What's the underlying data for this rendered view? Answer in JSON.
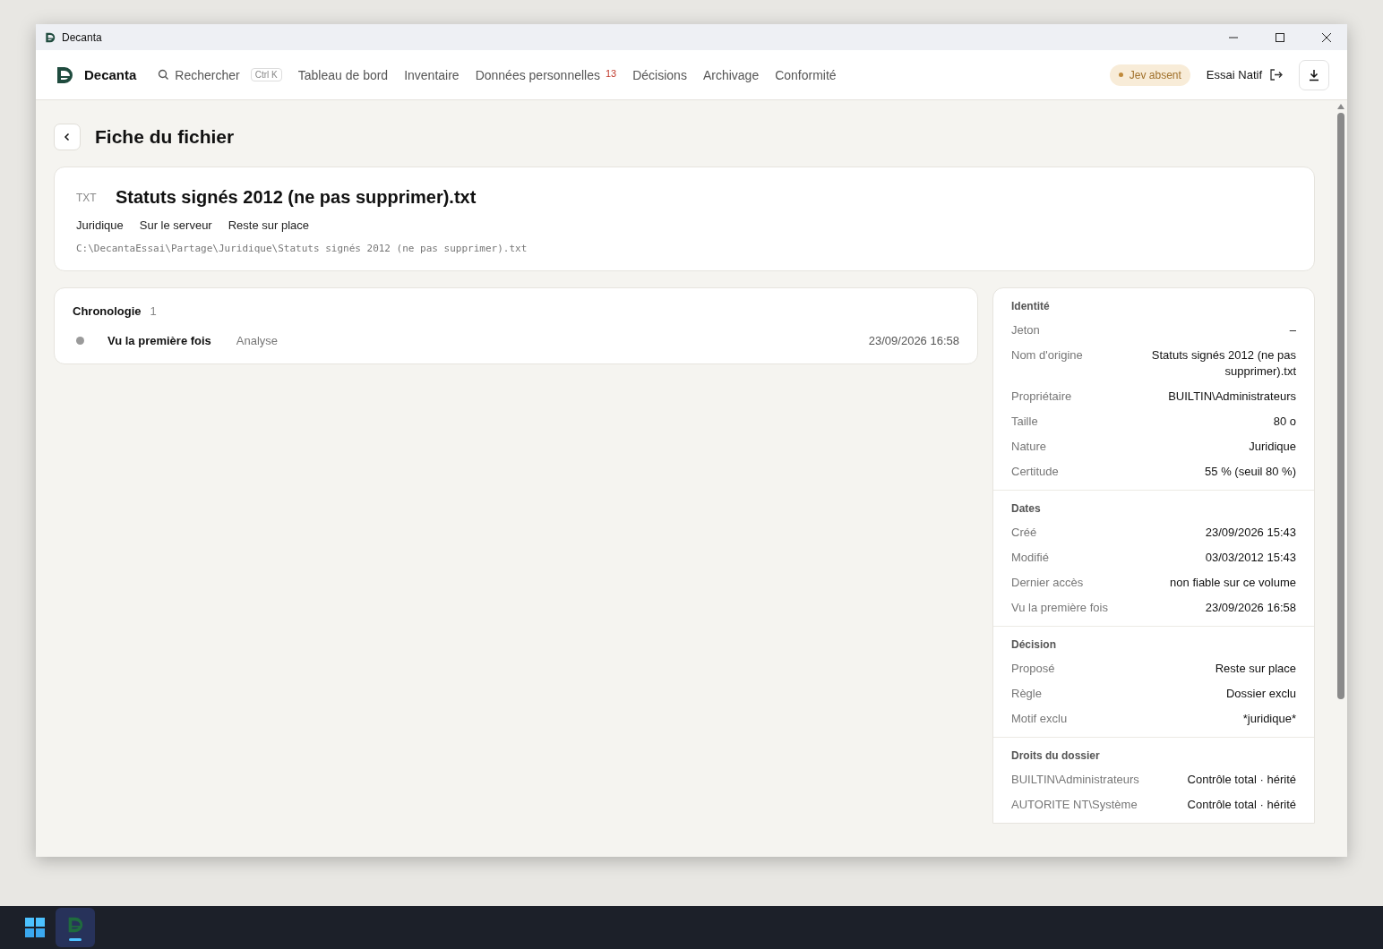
{
  "window": {
    "title": "Decanta"
  },
  "nav": {
    "brand": "Decanta",
    "search": {
      "label": "Rechercher",
      "shortcut": "Ctrl K"
    },
    "items": [
      {
        "label": "Tableau de bord"
      },
      {
        "label": "Inventaire"
      },
      {
        "label": "Données personnelles",
        "badge": "13"
      },
      {
        "label": "Décisions"
      },
      {
        "label": "Archivage"
      },
      {
        "label": "Conformité"
      }
    ],
    "status": "Jev absent",
    "user": "Essai Natif"
  },
  "page": {
    "title": "Fiche du fichier"
  },
  "file": {
    "type": "TXT",
    "name": "Statuts signés 2012 (ne pas supprimer).txt",
    "tags": [
      "Juridique",
      "Sur le serveur",
      "Reste sur place"
    ],
    "path": "C:\\DecantaEssai\\Partage\\Juridique\\Statuts signés 2012 (ne pas supprimer).txt"
  },
  "timeline": {
    "title": "Chronologie",
    "count": "1",
    "events": [
      {
        "label": "Vu la première fois",
        "source": "Analyse",
        "time": "23/09/2026 16:58"
      }
    ]
  },
  "details": [
    {
      "title": "Identité",
      "rows": [
        {
          "label": "Jeton",
          "value": "–"
        },
        {
          "label": "Nom d'origine",
          "value": "Statuts signés 2012 (ne pas supprimer).txt"
        },
        {
          "label": "Propriétaire",
          "value": "BUILTIN\\Administrateurs"
        },
        {
          "label": "Taille",
          "value": "80 o"
        },
        {
          "label": "Nature",
          "value": "Juridique"
        },
        {
          "label": "Certitude",
          "value": "55 % (seuil 80 %)"
        }
      ]
    },
    {
      "title": "Dates",
      "rows": [
        {
          "label": "Créé",
          "value": "23/09/2026 15:43"
        },
        {
          "label": "Modifié",
          "value": "03/03/2012 15:43"
        },
        {
          "label": "Dernier accès",
          "value": "non fiable sur ce volume"
        },
        {
          "label": "Vu la première fois",
          "value": "23/09/2026 16:58"
        }
      ]
    },
    {
      "title": "Décision",
      "rows": [
        {
          "label": "Proposé",
          "value": "Reste sur place"
        },
        {
          "label": "Règle",
          "value": "Dossier exclu"
        },
        {
          "label": "Motif exclu",
          "value": "*juridique*"
        }
      ]
    },
    {
      "title": "Droits du dossier",
      "rows": [
        {
          "label": "BUILTIN\\Administrateurs",
          "value": "Contrôle total · hérité"
        },
        {
          "label": "AUTORITE NT\\Système",
          "value": "Contrôle total · hérité"
        }
      ]
    }
  ]
}
